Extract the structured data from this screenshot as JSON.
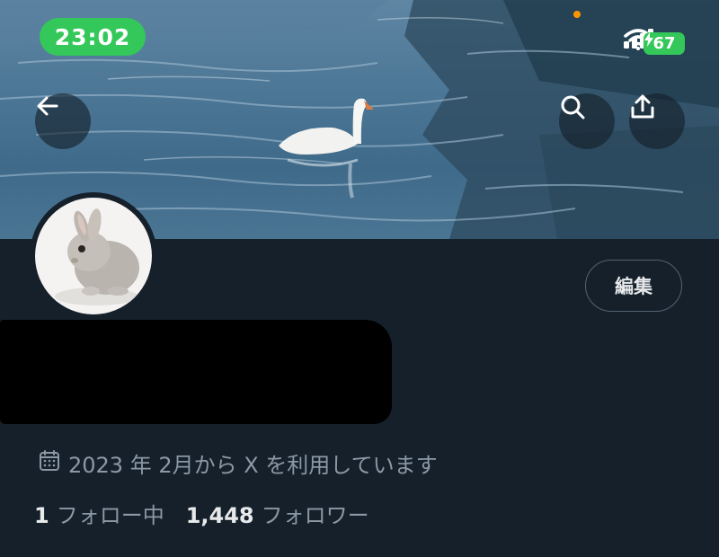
{
  "status_bar": {
    "time": "23:02",
    "battery": "67",
    "icons": [
      "signal-icon",
      "wifi-icon",
      "battery-charging-icon"
    ]
  },
  "header": {
    "back_icon": "arrow-left-icon",
    "search_icon": "search-icon",
    "share_icon": "share-icon"
  },
  "profile": {
    "edit_label": "編集",
    "joined": "2023 年 2月から X を利用しています",
    "following_count": "1",
    "following_label": "フォロー中",
    "followers_count": "1,448",
    "followers_label": "フォロワー"
  },
  "colors": {
    "background": "#15202b",
    "accent_green": "#34c759",
    "muted_text": "#8b98a5",
    "primary_text": "#e7e9ea"
  }
}
